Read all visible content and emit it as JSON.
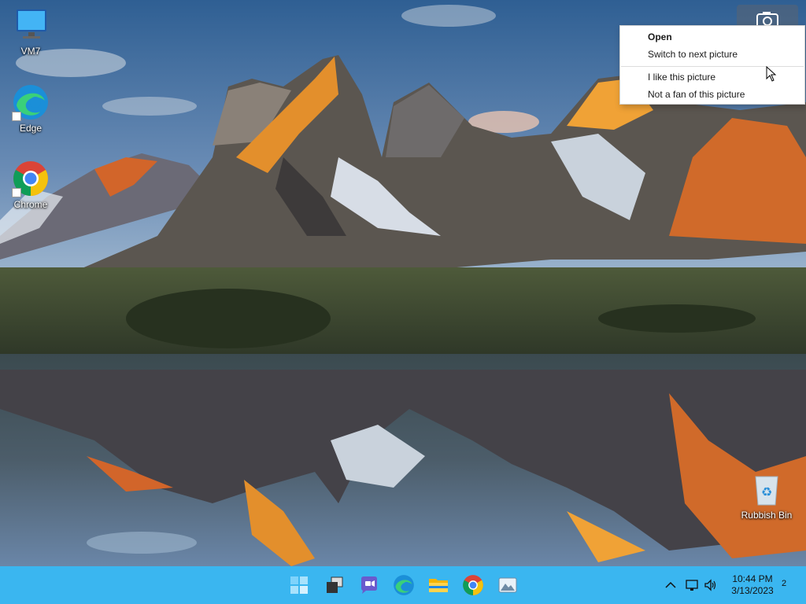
{
  "desktop": {
    "icons": [
      {
        "label": "VM7",
        "icon": "monitor-icon"
      },
      {
        "label": "Edge",
        "icon": "edge-icon"
      },
      {
        "label": "Chrome",
        "icon": "chrome-icon"
      },
      {
        "label": "Rubbish Bin",
        "icon": "recycle-bin-icon"
      }
    ],
    "camera_button_icon": "camera-icon"
  },
  "context_menu": {
    "items": [
      {
        "label": "Open",
        "bold": true
      },
      {
        "label": "Switch to next picture"
      },
      {
        "label": "I like this picture"
      },
      {
        "label": "Not a fan of this picture"
      }
    ]
  },
  "taskbar": {
    "apps": [
      {
        "name": "start-button",
        "icon": "windows-logo-icon"
      },
      {
        "name": "task-view-button",
        "icon": "task-view-icon"
      },
      {
        "name": "teams-chat-button",
        "icon": "chat-icon"
      },
      {
        "name": "edge-taskbar-button",
        "icon": "edge-icon"
      },
      {
        "name": "file-explorer-button",
        "icon": "folder-icon"
      },
      {
        "name": "chrome-taskbar-button",
        "icon": "chrome-icon"
      },
      {
        "name": "photos-button",
        "icon": "photos-icon"
      }
    ],
    "tray": {
      "time": "10:44 PM",
      "date": "3/13/2023",
      "notification_count": "2"
    }
  },
  "colors": {
    "taskbar": "#3ab6f0",
    "menu_background": "#ffffff"
  }
}
